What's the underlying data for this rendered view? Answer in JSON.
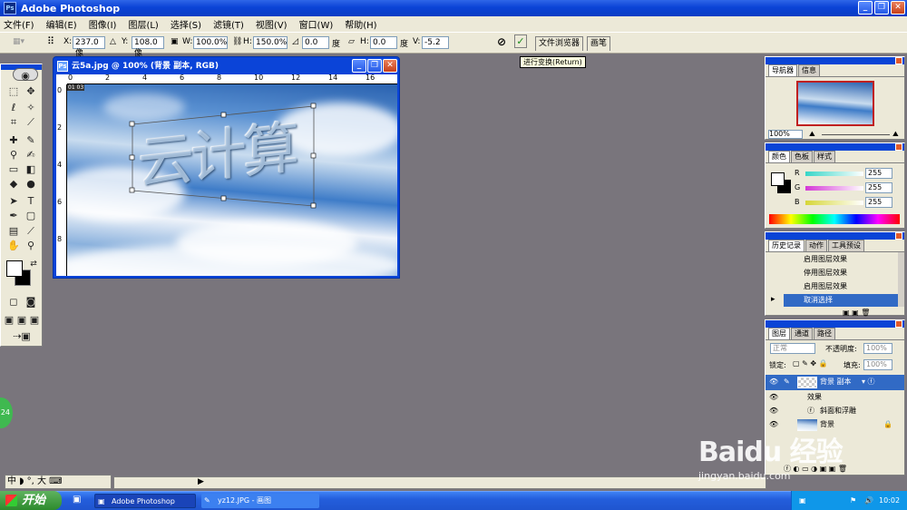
{
  "window": {
    "title": "Adobe Photoshop",
    "min": "_",
    "max": "❐",
    "close": "✕"
  },
  "menu": [
    "文件(F)",
    "编辑(E)",
    "图像(I)",
    "图层(L)",
    "选择(S)",
    "滤镜(T)",
    "视图(V)",
    "窗口(W)",
    "帮助(H)"
  ],
  "options": {
    "x_label": "X:",
    "x_value": "237.0 像",
    "y_label": "Y:",
    "y_value": "108.0 像",
    "w_label": "W:",
    "w_value": "100.0%",
    "h_label": "H:",
    "h_value": "150.0%",
    "angle_value": "0.0",
    "angle_unit": "度",
    "hskew_label": "H:",
    "hskew_value": "0.0",
    "hskew_unit": "度",
    "vskew_label": "V:",
    "vskew_value": "-5.2",
    "tab_file_browser": "文件浏览器",
    "tab_brushes": "画笔",
    "cancel_icon": "⊘",
    "commit_icon": "✓"
  },
  "tooltip": "进行变换(Return)",
  "document": {
    "title": "云5a.jpg @ 100% (背景 副本, RGB)",
    "ruler_top": [
      "0",
      "2",
      "4",
      "6",
      "8",
      "10",
      "12",
      "14",
      "16"
    ],
    "ruler_left": [
      "0",
      "2",
      "4",
      "6",
      "8"
    ],
    "page_marks": "01 03",
    "overlay_text": "云计算"
  },
  "navigator": {
    "tabs": [
      "导航器",
      "信息"
    ],
    "zoom": "100%"
  },
  "color": {
    "tabs": [
      "颜色",
      "色板",
      "样式"
    ],
    "channels": [
      {
        "label": "R",
        "value": "255",
        "color": "#37d6c8"
      },
      {
        "label": "G",
        "value": "255",
        "color": "#d437d6"
      },
      {
        "label": "B",
        "value": "255",
        "color": "#d6d637"
      }
    ]
  },
  "history": {
    "tabs": [
      "历史记录",
      "动作",
      "工具预设"
    ],
    "items": [
      "启用图层效果",
      "停用图层效果",
      "启用图层效果",
      "取消选择"
    ],
    "selected_index": 3
  },
  "layers": {
    "tabs": [
      "图层",
      "通道",
      "路径"
    ],
    "blend_mode": "正常",
    "opacity_label": "不透明度:",
    "opacity_value": "100%",
    "lock_label": "锁定:",
    "fill_label": "填充:",
    "fill_value": "100%",
    "rows": [
      {
        "name": "背景 副本",
        "type": "layer"
      },
      {
        "name": "效果",
        "type": "effects"
      },
      {
        "name": "斜面和浮雕",
        "type": "effect"
      },
      {
        "name": "背景",
        "type": "layer"
      }
    ]
  },
  "ime": {
    "text": "中 ◗ °, 大 ⌨"
  },
  "taskbar": {
    "start": "开始",
    "tasks": [
      "Adobe Photoshop",
      "yz12.JPG - 画图"
    ],
    "clock": "10:02"
  },
  "badge": "24",
  "watermark": {
    "brand": "Baidu 经验",
    "url": "jingyan.baidu.com"
  },
  "colors": {
    "titlebar": "#0b43d6",
    "selected": "#316ac5",
    "workspace": "#79757c"
  }
}
